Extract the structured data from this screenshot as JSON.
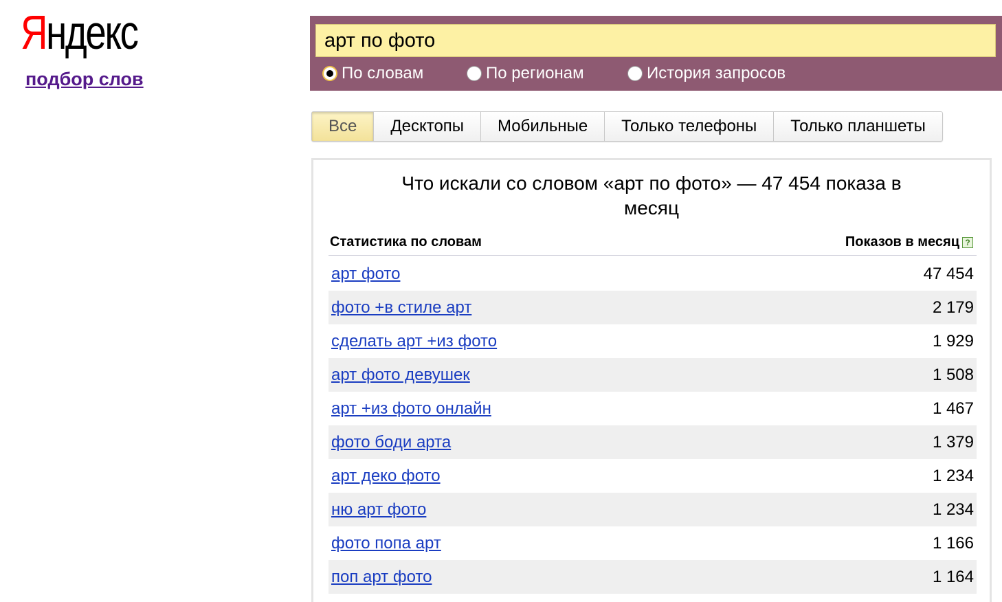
{
  "logo": {
    "first": "Я",
    "rest": "ндекс"
  },
  "service_link": "подбор слов",
  "search": {
    "value": "арт по фото"
  },
  "radios": [
    {
      "label": "По словам",
      "checked": true
    },
    {
      "label": "По регионам",
      "checked": false
    },
    {
      "label": "История запросов",
      "checked": false
    }
  ],
  "tabs": [
    {
      "label": "Все",
      "active": true
    },
    {
      "label": "Десктопы",
      "active": false
    },
    {
      "label": "Мобильные",
      "active": false
    },
    {
      "label": "Только телефоны",
      "active": false
    },
    {
      "label": "Только планшеты",
      "active": false
    }
  ],
  "results": {
    "title": "Что искали со словом «арт по фото» — 47 454 показа в месяц",
    "col_left": "Статистика по словам",
    "col_right": "Показов в месяц",
    "help": "?",
    "rows": [
      {
        "phrase": "арт фото",
        "count": "47 454"
      },
      {
        "phrase": "фото +в стиле арт",
        "count": "2 179"
      },
      {
        "phrase": "сделать арт +из фото",
        "count": "1 929"
      },
      {
        "phrase": "арт фото девушек",
        "count": "1 508"
      },
      {
        "phrase": "арт +из фото онлайн",
        "count": "1 467"
      },
      {
        "phrase": "фото боди арта",
        "count": "1 379"
      },
      {
        "phrase": "арт деко фото",
        "count": "1 234"
      },
      {
        "phrase": "ню арт фото",
        "count": "1 234"
      },
      {
        "phrase": "фото попа арт",
        "count": "1 166"
      },
      {
        "phrase": "поп арт фото",
        "count": "1 164"
      }
    ]
  }
}
